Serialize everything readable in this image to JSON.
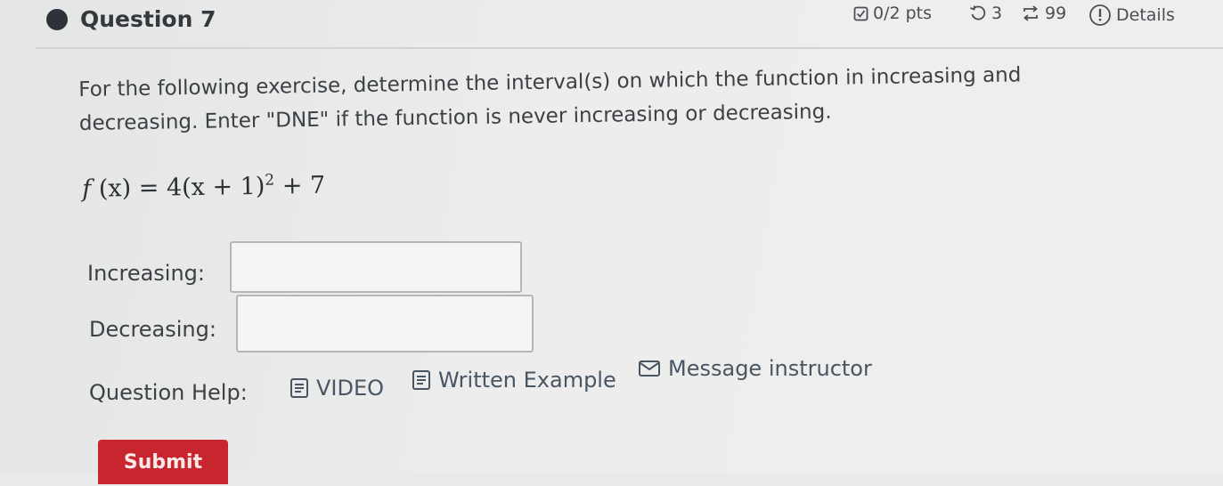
{
  "question": {
    "title": "Question 7",
    "points": "0/2 pts",
    "attempts": "3",
    "submissions": "99",
    "details_label": "Details"
  },
  "prompt": {
    "line1": "For the following exercise, determine the interval(s) on which the function in increasing and",
    "line2": "decreasing. Enter \"DNE\" if the function is never increasing or decreasing."
  },
  "formula": {
    "fn": "f",
    "arg": "(x)",
    "equals": "=",
    "coef": "4",
    "inner": "(x + 1)",
    "exponent": "2",
    "tail": "+ 7"
  },
  "answers": {
    "increasing_label": "Increasing:",
    "increasing_value": "",
    "decreasing_label": "Decreasing:",
    "decreasing_value": ""
  },
  "help": {
    "label": "Question Help:",
    "video": "VIDEO",
    "written_example": "Written Example",
    "message_instructor": "Message instructor"
  },
  "submit_label": "Submit"
}
